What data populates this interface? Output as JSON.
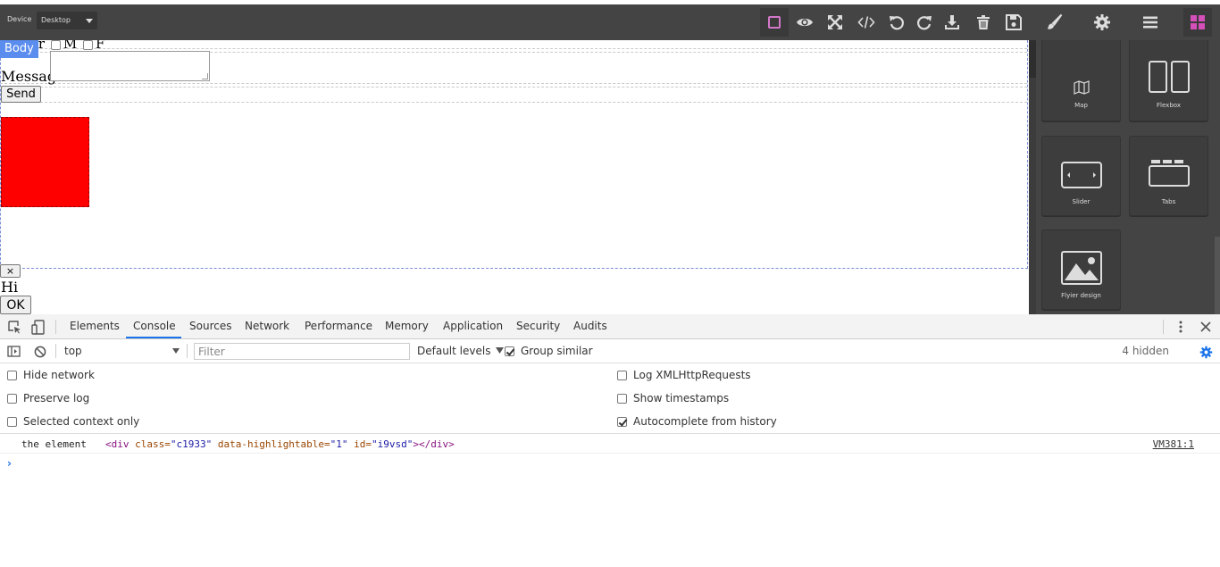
{
  "editor": {
    "device_label": "Device",
    "device_value": "Desktop",
    "toolbar_icons": [
      "borders-icon",
      "eye-icon",
      "fullscreen-icon",
      "code-icon",
      "undo-icon",
      "redo-icon",
      "download-icon",
      "trash-icon",
      "save-icon",
      "paint-brush-icon",
      "gear-icon",
      "menu-icon",
      "blocks-grid-icon"
    ]
  },
  "canvas": {
    "selected_badge": "Body",
    "gender_partial": "er",
    "gender_options": [
      "M",
      "F"
    ],
    "message_label": "Message",
    "send_label": "Send",
    "close_label": "×",
    "hi_text": "Hi",
    "ok_label": "OK"
  },
  "blocks": [
    {
      "label": "Map",
      "icon": "map-icon"
    },
    {
      "label": "Flexbox",
      "icon": "flexbox-icon"
    },
    {
      "label": "Slider",
      "icon": "slider-icon"
    },
    {
      "label": "Tabs",
      "icon": "tabs-icon"
    },
    {
      "label": "Flyier design",
      "icon": "image-icon"
    }
  ],
  "devtools": {
    "tabs": [
      "Elements",
      "Console",
      "Sources",
      "Network",
      "Performance",
      "Memory",
      "Application",
      "Security",
      "Audits"
    ],
    "active_tab": "Console",
    "context": "top",
    "filter_placeholder": "Filter",
    "levels": "Default levels",
    "group_similar": "Group similar",
    "hidden_count": "4 hidden",
    "settings_left": [
      {
        "label": "Hide network",
        "checked": false
      },
      {
        "label": "Preserve log",
        "checked": false
      },
      {
        "label": "Selected context only",
        "checked": false
      }
    ],
    "settings_right": [
      {
        "label": "Log XMLHttpRequests",
        "checked": false
      },
      {
        "label": "Show timestamps",
        "checked": false
      },
      {
        "label": "Autocomplete from history",
        "checked": true
      }
    ],
    "message": {
      "prefix": "the element",
      "tag_open": "<div",
      "attr1_name": " class=",
      "attr1_value": "\"c1933\"",
      "attr2_name": " data-highlightable=",
      "attr2_value": "\"1\"",
      "attr3_name": " id=",
      "attr3_value": "\"i9vsd\"",
      "tag_close": "></div>",
      "source": "VM381:1"
    },
    "prompt": "›"
  },
  "colors": {
    "editor_bg": "#444444",
    "accent_pink": "#d278c9",
    "canvas_red": "#ff0000",
    "devtools_accent": "#1a73e8"
  }
}
